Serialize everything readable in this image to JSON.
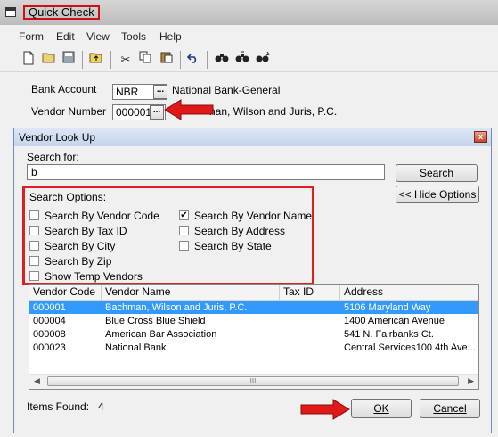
{
  "main_window": {
    "title": "Quick Check",
    "menu": [
      "Form",
      "Edit",
      "View",
      "Tools",
      "Help"
    ],
    "bank_account": {
      "label": "Bank Account",
      "code": "NBR",
      "name": "National Bank-General"
    },
    "vendor_number": {
      "label": "Vendor Number",
      "code": "000001",
      "name_partial": "han, Wilson and Juris, P.C."
    }
  },
  "toolbar": {
    "icons": [
      "new-icon",
      "open-icon",
      "save-icon",
      "up-folder-icon",
      "cut-icon",
      "copy-icon",
      "paste-icon",
      "undo-icon",
      "find-icon",
      "find-next-icon",
      "replace-icon"
    ]
  },
  "dialog": {
    "title": "Vendor Look Up",
    "close_glyph": "x",
    "search_label": "Search for:",
    "search_value": "b",
    "search_button": "Search",
    "hide_options_button": "<< Hide Options",
    "search_options": {
      "heading": "Search Options:",
      "items": [
        {
          "label": "Search By Vendor Code",
          "checked": false
        },
        {
          "label": "Search By Tax ID",
          "checked": false
        },
        {
          "label": "Search By City",
          "checked": false
        },
        {
          "label": "Search By Zip",
          "checked": false
        },
        {
          "label": "Show Temp Vendors",
          "checked": false
        },
        {
          "label": "Search By Vendor Name",
          "checked": true
        },
        {
          "label": "Search By Address",
          "checked": false
        },
        {
          "label": "Search By State",
          "checked": false
        }
      ]
    },
    "list": {
      "columns": [
        "Vendor Code",
        "Vendor Name",
        "Tax ID",
        "Address"
      ],
      "rows": [
        {
          "code": "000001",
          "name": "Bachman, Wilson and Juris, P.C.",
          "tax_id": "",
          "address": "5106 Maryland Way",
          "selected": true
        },
        {
          "code": "000004",
          "name": "Blue Cross Blue Shield",
          "tax_id": "",
          "address": "1400 American Avenue",
          "selected": false
        },
        {
          "code": "000008",
          "name": "American Bar Association",
          "tax_id": "",
          "address": "541 N. Fairbanks Ct.",
          "selected": false
        },
        {
          "code": "000023",
          "name": "National Bank",
          "tax_id": "",
          "address": "Central Services100 4th Ave...",
          "selected": false
        }
      ]
    },
    "items_found_label": "Items Found:",
    "items_found_count": "4",
    "ok_button": "OK",
    "cancel_button": "Cancel"
  },
  "colors": {
    "highlight_red": "#e02020",
    "selection_blue": "#3399ff",
    "arrow_red": "#e01818"
  }
}
